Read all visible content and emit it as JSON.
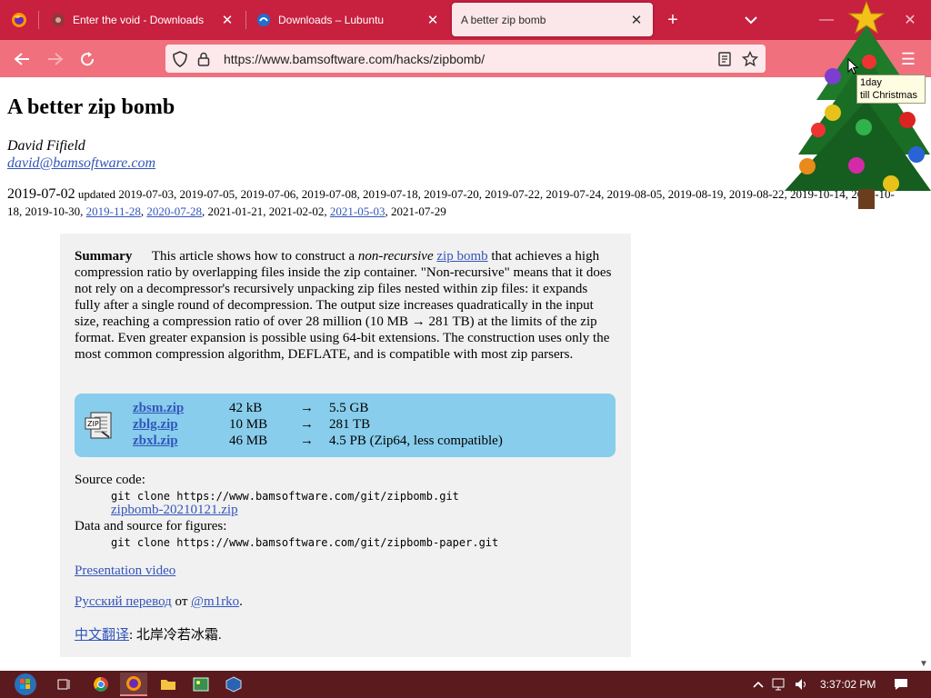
{
  "browser": {
    "tabs": [
      {
        "title": "Enter the void - Downloads",
        "active": false
      },
      {
        "title": "Downloads – Lubuntu",
        "active": false
      },
      {
        "title": "A better zip bomb",
        "active": true
      }
    ],
    "url": "https://www.bamsoftware.com/hacks/zipbomb/",
    "accent_color": "#c8203f",
    "navbar_color": "#f0707d"
  },
  "widget": {
    "tooltip_line1": "1day",
    "tooltip_line2": "till Christmas"
  },
  "article": {
    "title": "A better zip bomb",
    "author": "David Fifield",
    "email": "david@bamsoftware.com",
    "date_first": "2019-07-02",
    "updated_label": "updated",
    "dates_plain_1": "2019-07-03, 2019-07-05, 2019-07-06, 2019-07-08, 2019-07-18, 2019-07-20, 2019-07-22, 2019-07-24, 2019-08-05, 2019-08-19, 2019-08-22, 2019-10-14, 2019-10-18, 2019-10-30,",
    "date_link_1": "2019-11-28",
    "date_link_2": "2020-07-28",
    "dates_plain_2": ", 2021-01-21, 2021-02-02,",
    "date_link_3": "2021-05-03",
    "dates_plain_3": ", 2021-07-29",
    "summary_label": "Summary",
    "summary_pre": "This article shows how to construct a",
    "summary_em": "non-recursive",
    "summary_link": "zip bomb",
    "summary_post": "that achieves a high compression ratio by overlapping files inside the zip container. \"Non-recursive\" means that it does not rely on a decompressor's recursively unpacking zip files nested within zip files: it expands fully after a single round of decompression. The output size increases quadratically in the input size, reaching a compression ratio of over 28 million (10 MB → 281 TB) at the limits of the zip format. Even greater expansion is possible using 64-bit extensions. The construction uses only the most common compression algorithm, DEFLATE, and is compatible with most zip parsers.",
    "downloads": [
      {
        "file": "zbsm.zip",
        "size": "42 kB",
        "arrow": "→",
        "output": "5.5 GB"
      },
      {
        "file": "zblg.zip",
        "size": "10 MB",
        "arrow": "→",
        "output": "281 TB"
      },
      {
        "file": "zbxl.zip",
        "size": "46 MB",
        "arrow": "→",
        "output": "4.5 PB (Zip64, less compatible)"
      }
    ],
    "source_label": "Source code:",
    "source_cmd": "git clone https://www.bamsoftware.com/git/zipbomb.git",
    "source_zip": "zipbomb-20210121.zip",
    "data_label": "Data and source for figures:",
    "data_cmd": "git clone https://www.bamsoftware.com/git/zipbomb-paper.git",
    "presentation": "Presentation video",
    "ru_link": "Русский перевод",
    "ru_mid": "от",
    "ru_author": "@m1rko",
    "ru_end": ".",
    "zh_link": "中文翻译",
    "zh_rest": ": 北岸冷若冰霜."
  },
  "taskbar": {
    "clock": "3:37:02 PM",
    "bg_color": "#5a1a1e"
  }
}
